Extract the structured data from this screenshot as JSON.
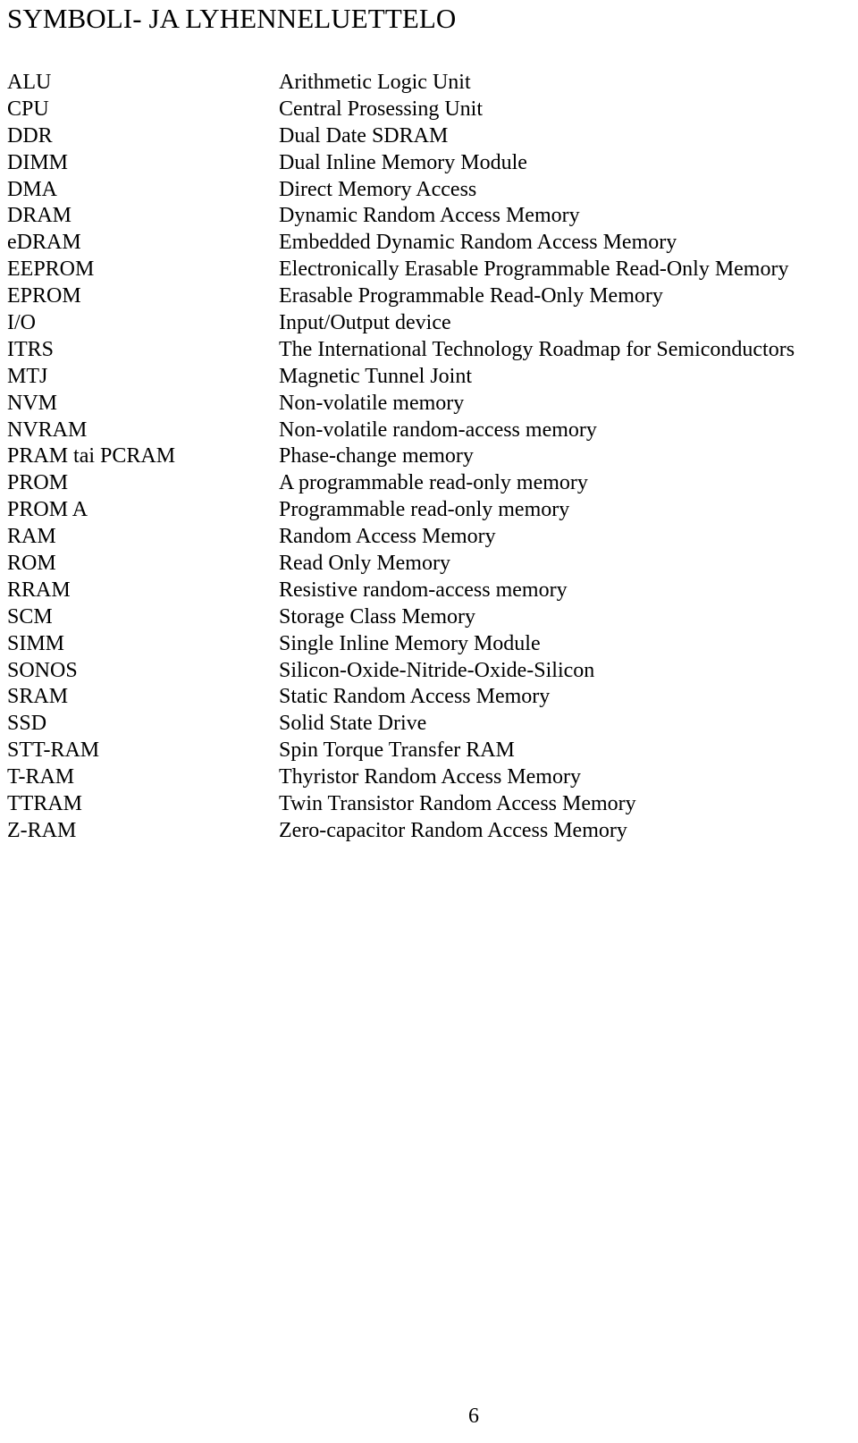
{
  "document": {
    "title": "SYMBOLI- JA LYHENNELUETTELO",
    "page_number": "6"
  },
  "abbreviations": [
    {
      "term": "ALU",
      "definition": "Arithmetic Logic Unit"
    },
    {
      "term": "CPU",
      "definition": "Central Prosessing Unit"
    },
    {
      "term": "DDR",
      "definition": "Dual Date SDRAM"
    },
    {
      "term": "DIMM",
      "definition": "Dual Inline Memory Module"
    },
    {
      "term": "DMA",
      "definition": "Direct Memory Access"
    },
    {
      "term": "DRAM",
      "definition": "Dynamic Random Access Memory"
    },
    {
      "term": "eDRAM",
      "definition": "Embedded Dynamic Random Access Memory"
    },
    {
      "term": "EEPROM",
      "definition": "Electronically Erasable Programmable Read-Only Memory"
    },
    {
      "term": "EPROM",
      "definition": "Erasable Programmable Read-Only Memory"
    },
    {
      "term": "I/O",
      "definition": "Input/Output device"
    },
    {
      "term": "ITRS",
      "definition": "The International Technology Roadmap for Semiconductors"
    },
    {
      "term": "MTJ",
      "definition": "Magnetic Tunnel Joint"
    },
    {
      "term": "NVM",
      "definition": "Non-volatile memory"
    },
    {
      "term": "NVRAM",
      "definition": "Non-volatile random-access memory"
    },
    {
      "term": "PRAM tai PCRAM",
      "definition": "Phase-change memory"
    },
    {
      "term": "PROM",
      "definition": "A programmable read-only memory"
    },
    {
      "term": "PROM A",
      "definition": "Programmable read-only memory"
    },
    {
      "term": "RAM",
      "definition": "Random Access Memory"
    },
    {
      "term": "ROM",
      "definition": "Read Only Memory"
    },
    {
      "term": "RRAM",
      "definition": "Resistive random-access memory"
    },
    {
      "term": "SCM",
      "definition": "Storage Class Memory"
    },
    {
      "term": "SIMM",
      "definition": "Single Inline Memory Module"
    },
    {
      "term": "SONOS",
      "definition": "Silicon-Oxide-Nitride-Oxide-Silicon"
    },
    {
      "term": "SRAM",
      "definition": "Static Random Access Memory"
    },
    {
      "term": "SSD",
      "definition": "Solid State Drive"
    },
    {
      "term": "STT-RAM",
      "definition": "Spin Torque Transfer RAM"
    },
    {
      "term": "T-RAM",
      "definition": "Thyristor Random Access Memory"
    },
    {
      "term": "TTRAM",
      "definition": "Twin Transistor Random Access Memory"
    },
    {
      "term": "Z-RAM",
      "definition": "Zero-capacitor Random Access Memory"
    }
  ]
}
